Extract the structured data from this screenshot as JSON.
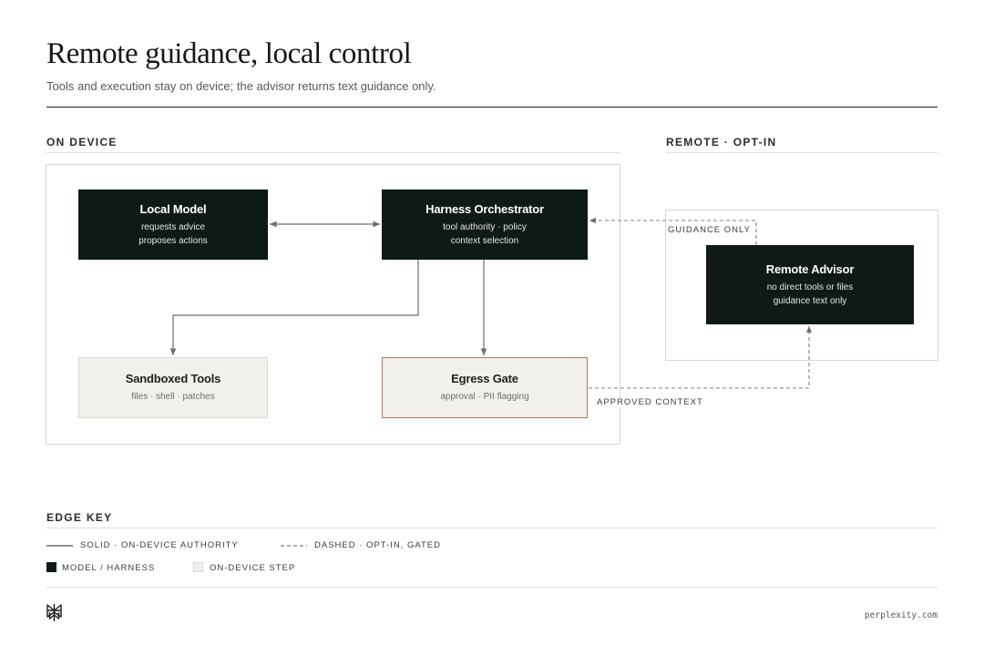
{
  "header": {
    "title": "Remote guidance, local control",
    "subtitle": "Tools and execution stay on device; the advisor returns text guidance only."
  },
  "sections": {
    "on_device": "ON DEVICE",
    "remote": "REMOTE · OPT-IN"
  },
  "nodes": {
    "local_model": {
      "title": "Local Model",
      "lines": [
        "requests advice",
        "proposes actions"
      ]
    },
    "harness": {
      "title": "Harness Orchestrator",
      "lines": [
        "tool authority · policy",
        "context selection"
      ]
    },
    "sandbox": {
      "title": "Sandboxed Tools",
      "lines": [
        "files · shell · patches"
      ]
    },
    "egress": {
      "title": "Egress Gate",
      "lines": [
        "approval · PII flagging"
      ]
    },
    "advisor": {
      "title": "Remote Advisor",
      "lines": [
        "no direct tools or files",
        "guidance text only"
      ]
    }
  },
  "edge_labels": {
    "guidance_only": "GUIDANCE ONLY",
    "approved_context": "APPROVED CONTEXT"
  },
  "edge_key": {
    "title": "EDGE KEY",
    "solid": "SOLID · ON-DEVICE AUTHORITY",
    "dashed": "DASHED · OPT-IN, GATED",
    "model_harness": "MODEL / HARNESS",
    "on_device_step": "ON-DEVICE STEP"
  },
  "footer": {
    "logo_icon": "perplexity-logo-icon",
    "url": "perplexity.com"
  },
  "colors": {
    "dark_node": "#0f1a17",
    "light_node": "#f1f0ea",
    "gate_border": "#b8735d",
    "edge": "#6b6e6c"
  }
}
